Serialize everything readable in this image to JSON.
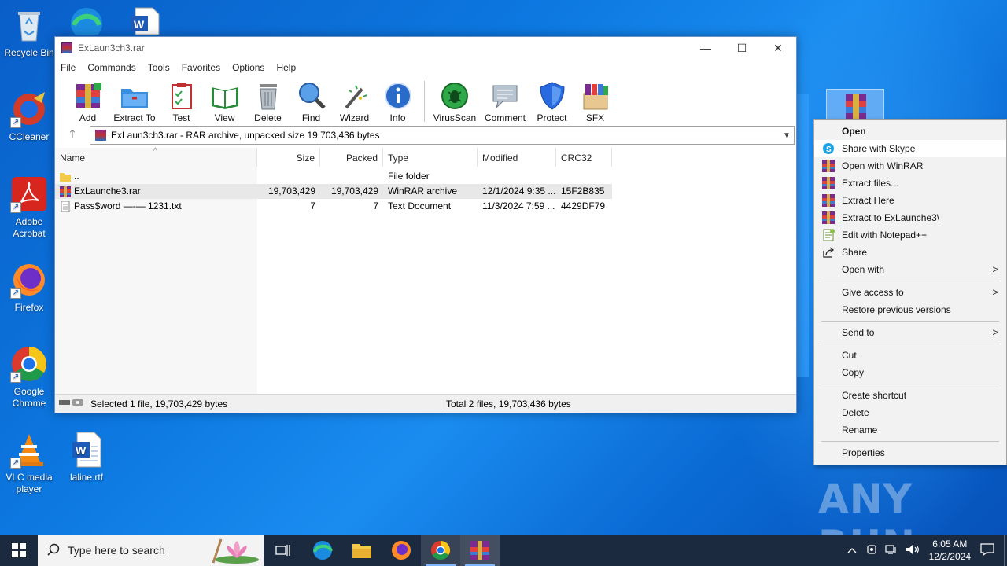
{
  "desktop": {
    "icons": [
      {
        "label": "Recycle Bin"
      },
      {
        "label": "CCleaner"
      },
      {
        "label": "Adobe Acrobat"
      },
      {
        "label": "Firefox"
      },
      {
        "label": "Google Chrome"
      },
      {
        "label": "VLC media player"
      },
      {
        "label": "laline.rtf"
      }
    ],
    "watermark": "ANY RUN"
  },
  "window": {
    "title": "ExLaun3ch3.rar",
    "menu": [
      "File",
      "Commands",
      "Tools",
      "Favorites",
      "Options",
      "Help"
    ],
    "toolbar": [
      "Add",
      "Extract To",
      "Test",
      "View",
      "Delete",
      "Find",
      "Wizard",
      "Info",
      "VirusScan",
      "Comment",
      "Protect",
      "SFX"
    ],
    "address": "ExLaun3ch3.rar - RAR archive, unpacked size 19,703,436 bytes",
    "columns": {
      "name": "Name",
      "size": "Size",
      "packed": "Packed",
      "type": "Type",
      "modified": "Modified",
      "crc": "CRC32"
    },
    "rows": [
      {
        "name": "..",
        "size": "",
        "packed": "",
        "type": "File folder",
        "modified": "",
        "crc": "",
        "icon": "folder-icon"
      },
      {
        "name": "ExLaunche3.rar",
        "size": "19,703,429",
        "packed": "19,703,429",
        "type": "WinRAR archive",
        "modified": "12/1/2024 9:35 ...",
        "crc": "15F2B835",
        "icon": "rar-icon"
      },
      {
        "name": "Pass$word —-— 1231.txt",
        "size": "7",
        "packed": "7",
        "type": "Text Document",
        "modified": "11/3/2024 7:59 ...",
        "crc": "4429DF79",
        "icon": "text-file-icon"
      }
    ],
    "status_left": "Selected 1 file, 19,703,429 bytes",
    "status_right": "Total 2 files, 19,703,436 bytes"
  },
  "context_menu": {
    "items": [
      {
        "label": "Open"
      },
      {
        "label": "Share with Skype"
      },
      {
        "label": "Open with WinRAR"
      },
      {
        "label": "Extract files..."
      },
      {
        "label": "Extract Here"
      },
      {
        "label": "Extract to ExLaunche3\\"
      },
      {
        "label": "Edit with Notepad++"
      },
      {
        "label": "Share"
      },
      {
        "label": "Open with"
      },
      {
        "label": "Give access to"
      },
      {
        "label": "Restore previous versions"
      },
      {
        "label": "Send to"
      },
      {
        "label": "Cut"
      },
      {
        "label": "Copy"
      },
      {
        "label": "Create shortcut"
      },
      {
        "label": "Delete"
      },
      {
        "label": "Rename"
      },
      {
        "label": "Properties"
      }
    ]
  },
  "taskbar": {
    "search_placeholder": "Type here to search",
    "time": "6:05 AM",
    "date": "12/2/2024"
  }
}
